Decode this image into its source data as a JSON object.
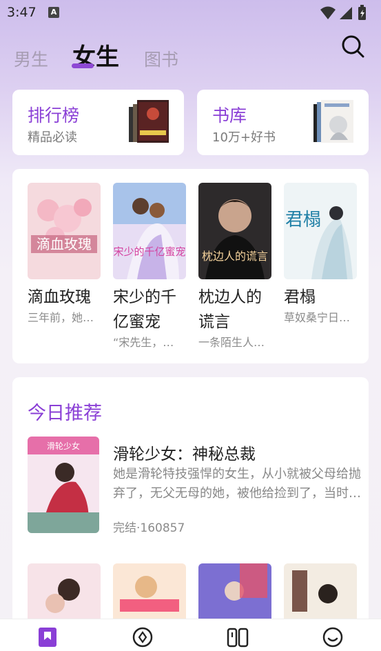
{
  "status_bar": {
    "time": "3:47",
    "notification_badge": "A"
  },
  "tabs": [
    {
      "label": "男生",
      "active": false
    },
    {
      "label": "女生",
      "active": true
    },
    {
      "label": "图书",
      "active": false
    }
  ],
  "quick_cards": {
    "rank": {
      "title": "排行榜",
      "subtitle": "精品必读"
    },
    "library": {
      "title": "书库",
      "subtitle": "10万+好书"
    }
  },
  "featured_books": [
    {
      "title": "滴血玫瑰",
      "desc": "三年前，她…",
      "cover_text": "滴血玫瑰"
    },
    {
      "title": "宋少的千亿蜜宠",
      "desc": "“宋先生，…",
      "cover_text": "宋少的千亿蜜宠"
    },
    {
      "title": "枕边人的谎言",
      "desc": "一条陌生人…",
      "cover_text": "枕边人的谎言"
    },
    {
      "title": "君榻",
      "desc": "草奴桑宁日…",
      "cover_text": "君榻"
    }
  ],
  "recommend": {
    "heading": "今日推荐",
    "book": {
      "title": "滑轮少女：神秘总裁",
      "desc": "她是滑轮特技强悍的女生，从小就被父母给抛弃了，无父无母的她，被他给捡到了，当时…",
      "meta": "完结·160857",
      "cover_text": "滑轮少女"
    }
  },
  "bottom_nav": [
    {
      "icon": "bookmark-icon",
      "active": true
    },
    {
      "icon": "compass-icon",
      "active": false
    },
    {
      "icon": "bookshelf-icon",
      "active": false
    },
    {
      "icon": "smiley-icon",
      "active": false
    }
  ],
  "colors": {
    "accent": "#8a3fd6",
    "inactive_tab": "#a79db3"
  }
}
